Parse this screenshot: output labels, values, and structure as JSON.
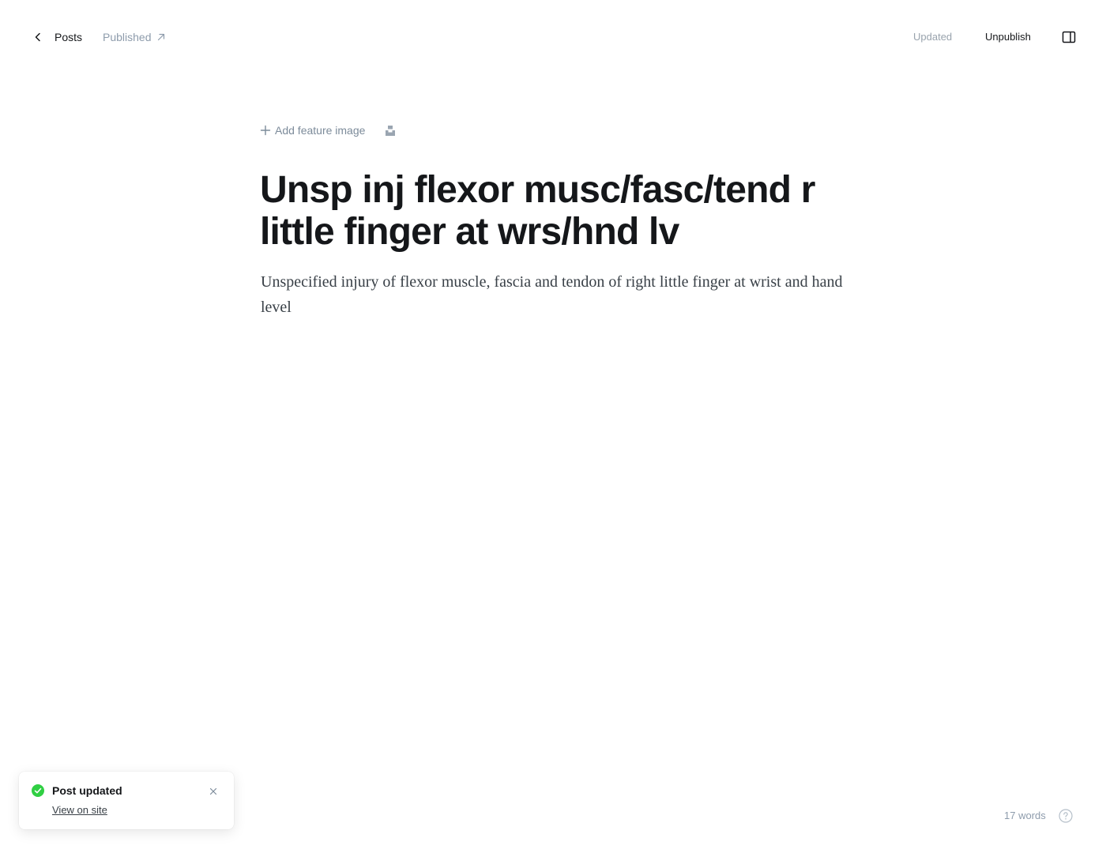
{
  "header": {
    "back_label": "Posts",
    "status_label": "Published",
    "updated_label": "Updated",
    "unpublish_label": "Unpublish"
  },
  "editor": {
    "add_feature_image_label": "Add feature image",
    "title": "Unsp inj flexor musc/fasc/tend r little finger at wrs/hnd lv",
    "excerpt": "Unspecified injury of flexor muscle, fascia and tendon of right little finger at wrist and hand level"
  },
  "toast": {
    "title": "Post updated",
    "link_label": "View on site"
  },
  "footer": {
    "word_count": "17 words"
  },
  "icons": {
    "back": "chevron-left-icon",
    "status": "arrow-up-right-icon",
    "sidebar": "sidebar-toggle-icon",
    "add": "plus-icon",
    "unsplash": "unsplash-icon",
    "success": "check-circle-icon",
    "close": "close-icon",
    "help": "help-circle-icon"
  },
  "colors": {
    "success": "#30cf43",
    "muted": "#8e9cac",
    "text": "#15171a"
  }
}
